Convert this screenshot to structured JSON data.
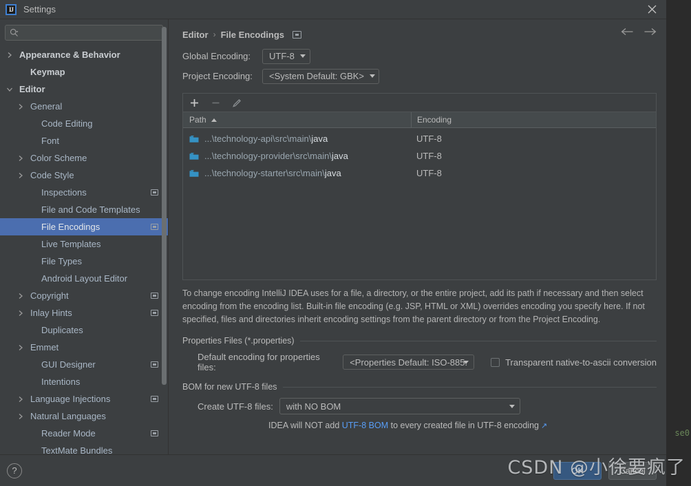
{
  "window": {
    "title": "Settings",
    "logo_icon": "intellij-idea-logo",
    "close_icon": "close-icon"
  },
  "background_ide": {
    "code_fragment": "se0"
  },
  "search": {
    "icon": "search-icon",
    "value": "",
    "placeholder": ""
  },
  "sidebar": {
    "items": [
      {
        "label": "Appearance & Behavior",
        "indent": 0,
        "twisty": "chevron-right",
        "bold": true,
        "badge": false,
        "selected": false
      },
      {
        "label": "Keymap",
        "indent": 1,
        "twisty": "none",
        "bold": true,
        "badge": false,
        "selected": false
      },
      {
        "label": "Editor",
        "indent": 0,
        "twisty": "chevron-down",
        "bold": true,
        "badge": false,
        "selected": false
      },
      {
        "label": "General",
        "indent": 1,
        "twisty": "chevron-right",
        "bold": false,
        "badge": false,
        "selected": false
      },
      {
        "label": "Code Editing",
        "indent": 2,
        "twisty": "none",
        "bold": false,
        "badge": false,
        "selected": false
      },
      {
        "label": "Font",
        "indent": 2,
        "twisty": "none",
        "bold": false,
        "badge": false,
        "selected": false
      },
      {
        "label": "Color Scheme",
        "indent": 1,
        "twisty": "chevron-right",
        "bold": false,
        "badge": false,
        "selected": false
      },
      {
        "label": "Code Style",
        "indent": 1,
        "twisty": "chevron-right",
        "bold": false,
        "badge": false,
        "selected": false
      },
      {
        "label": "Inspections",
        "indent": 2,
        "twisty": "none",
        "bold": false,
        "badge": true,
        "selected": false
      },
      {
        "label": "File and Code Templates",
        "indent": 2,
        "twisty": "none",
        "bold": false,
        "badge": false,
        "selected": false
      },
      {
        "label": "File Encodings",
        "indent": 2,
        "twisty": "none",
        "bold": false,
        "badge": true,
        "selected": true
      },
      {
        "label": "Live Templates",
        "indent": 2,
        "twisty": "none",
        "bold": false,
        "badge": false,
        "selected": false
      },
      {
        "label": "File Types",
        "indent": 2,
        "twisty": "none",
        "bold": false,
        "badge": false,
        "selected": false
      },
      {
        "label": "Android Layout Editor",
        "indent": 2,
        "twisty": "none",
        "bold": false,
        "badge": false,
        "selected": false
      },
      {
        "label": "Copyright",
        "indent": 1,
        "twisty": "chevron-right",
        "bold": false,
        "badge": true,
        "selected": false
      },
      {
        "label": "Inlay Hints",
        "indent": 1,
        "twisty": "chevron-right",
        "bold": false,
        "badge": true,
        "selected": false
      },
      {
        "label": "Duplicates",
        "indent": 2,
        "twisty": "none",
        "bold": false,
        "badge": false,
        "selected": false
      },
      {
        "label": "Emmet",
        "indent": 1,
        "twisty": "chevron-right",
        "bold": false,
        "badge": false,
        "selected": false
      },
      {
        "label": "GUI Designer",
        "indent": 2,
        "twisty": "none",
        "bold": false,
        "badge": true,
        "selected": false
      },
      {
        "label": "Intentions",
        "indent": 2,
        "twisty": "none",
        "bold": false,
        "badge": false,
        "selected": false
      },
      {
        "label": "Language Injections",
        "indent": 1,
        "twisty": "chevron-right",
        "bold": false,
        "badge": true,
        "selected": false
      },
      {
        "label": "Natural Languages",
        "indent": 1,
        "twisty": "chevron-right",
        "bold": false,
        "badge": false,
        "selected": false
      },
      {
        "label": "Reader Mode",
        "indent": 2,
        "twisty": "none",
        "bold": false,
        "badge": true,
        "selected": false
      },
      {
        "label": "TextMate Bundles",
        "indent": 2,
        "twisty": "none",
        "bold": false,
        "badge": false,
        "selected": false
      }
    ]
  },
  "content": {
    "breadcrumb": {
      "parent": "Editor",
      "separator": "›",
      "current": "File Encodings",
      "badge_icon": "settings-badge-icon"
    },
    "nav": {
      "back_icon": "arrow-left-icon",
      "forward_icon": "arrow-right-icon"
    },
    "global_encoding": {
      "label": "Global Encoding:",
      "value": "UTF-8"
    },
    "project_encoding": {
      "label": "Project Encoding:",
      "value": "<System Default: GBK>"
    },
    "table": {
      "toolbar": {
        "add_icon": "plus-icon",
        "remove_icon": "minus-icon",
        "edit_icon": "pencil-icon"
      },
      "columns": [
        "Path",
        "Encoding"
      ],
      "sort_column": "Path",
      "sort_direction": "ascending",
      "rows": [
        {
          "icon": "folder-icon",
          "path_prefix": "...\\technology-api\\src\\main\\",
          "path_leaf": "java",
          "encoding": "UTF-8"
        },
        {
          "icon": "folder-icon",
          "path_prefix": "...\\technology-provider\\src\\main\\",
          "path_leaf": "java",
          "encoding": "UTF-8"
        },
        {
          "icon": "folder-icon",
          "path_prefix": "...\\technology-starter\\src\\main\\",
          "path_leaf": "java",
          "encoding": "UTF-8"
        }
      ]
    },
    "description": "To change encoding IntelliJ IDEA uses for a file, a directory, or the entire project, add its path if necessary and then select encoding from the encoding list. Built-in file encoding (e.g. JSP, HTML or XML) overrides encoding you specify here. If not specified, files and directories inherit encoding settings from the parent directory or from the Project Encoding.",
    "properties_group": {
      "title": "Properties Files (*.properties)",
      "field_label": "Default encoding for properties files:",
      "field_value": "<Properties Default: ISO-885.",
      "checkbox_label": "Transparent native-to-ascii conversion",
      "checkbox_checked": false
    },
    "bom_group": {
      "title": "BOM for new UTF-8 files",
      "field_label": "Create UTF-8 files:",
      "field_value": "with NO BOM",
      "hint_prefix": "IDEA will NOT add ",
      "hint_link": "UTF-8 BOM",
      "hint_suffix": " to every created file in UTF-8 encoding",
      "hint_external_icon": "↗"
    }
  },
  "footer": {
    "help_label": "?",
    "ok_label": "OK",
    "cancel_label": "Cancel"
  },
  "watermark": {
    "text": "CSDN @小徐要疯了"
  },
  "colors": {
    "dialog_bg": "#3c3f41",
    "selection_blue": "#4b6eaf",
    "ok_button": "#365880",
    "link_blue": "#589df6",
    "folder_blue": "#3592c4"
  }
}
